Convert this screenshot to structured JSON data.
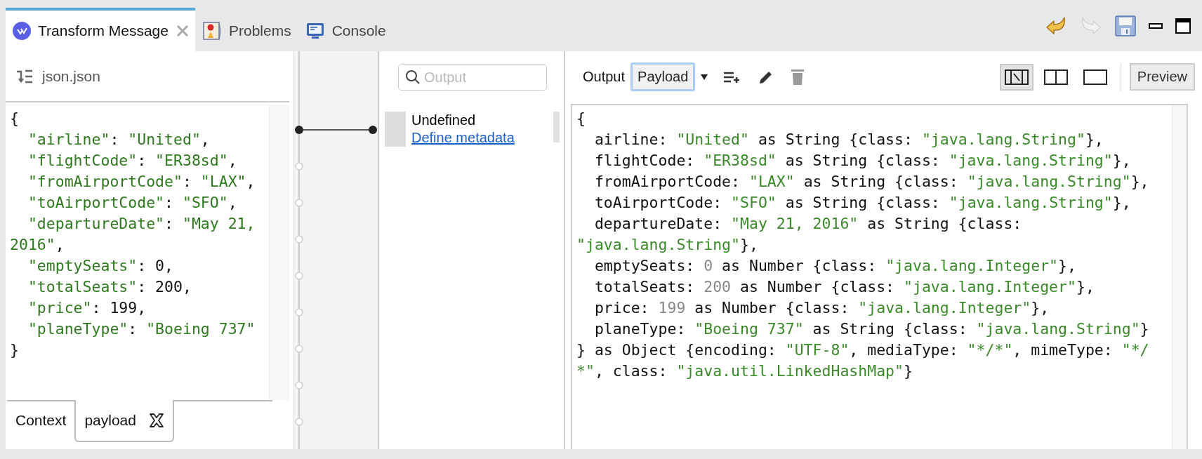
{
  "editor_tabs": [
    {
      "label": "Transform Message",
      "kind": "transform",
      "selected": true,
      "closable": true
    },
    {
      "label": "Problems",
      "kind": "problems",
      "selected": false,
      "closable": false
    },
    {
      "label": "Console",
      "kind": "console",
      "selected": false,
      "closable": false
    }
  ],
  "window_actions": [
    {
      "kind": "undo",
      "disabled": false
    },
    {
      "kind": "redo",
      "disabled": true
    },
    {
      "kind": "save"
    },
    {
      "kind": "minimize"
    },
    {
      "kind": "maximize"
    }
  ],
  "input_panel": {
    "title": "json.json",
    "code": [
      [
        {
          "kind": "plain",
          "text": "{"
        }
      ],
      [
        {
          "kind": "string",
          "text": "  \"airline\""
        },
        {
          "kind": "plain",
          "text": ": "
        },
        {
          "kind": "string",
          "text": "\"United\""
        },
        {
          "kind": "plain",
          "text": ","
        }
      ],
      [
        {
          "kind": "string",
          "text": "  \"flightCode\""
        },
        {
          "kind": "plain",
          "text": ": "
        },
        {
          "kind": "string",
          "text": "\"ER38sd\""
        },
        {
          "kind": "plain",
          "text": ","
        }
      ],
      [
        {
          "kind": "string",
          "text": "  \"fromAirportCode\""
        },
        {
          "kind": "plain",
          "text": ": "
        },
        {
          "kind": "string",
          "text": "\"LAX\""
        },
        {
          "kind": "plain",
          "text": ","
        }
      ],
      [
        {
          "kind": "string",
          "text": "  \"toAirportCode\""
        },
        {
          "kind": "plain",
          "text": ": "
        },
        {
          "kind": "string",
          "text": "\"SFO\""
        },
        {
          "kind": "plain",
          "text": ","
        }
      ],
      [
        {
          "kind": "string",
          "text": "  \"departureDate\""
        },
        {
          "kind": "plain",
          "text": ": "
        },
        {
          "kind": "string",
          "text": "\"May 21,"
        }
      ],
      [
        {
          "kind": "string",
          "text": "2016\""
        },
        {
          "kind": "plain",
          "text": ","
        }
      ],
      [
        {
          "kind": "string",
          "text": "  \"emptySeats\""
        },
        {
          "kind": "plain",
          "text": ": 0,"
        }
      ],
      [
        {
          "kind": "string",
          "text": "  \"totalSeats\""
        },
        {
          "kind": "plain",
          "text": ": 200,"
        }
      ],
      [
        {
          "kind": "string",
          "text": "  \"price\""
        },
        {
          "kind": "plain",
          "text": ": 199,"
        }
      ],
      [
        {
          "kind": "string",
          "text": "  \"planeType\""
        },
        {
          "kind": "plain",
          "text": ": "
        },
        {
          "kind": "string",
          "text": "\"Boeing 737\""
        }
      ],
      [
        {
          "kind": "plain",
          "text": "}"
        }
      ]
    ],
    "tabs": [
      {
        "label": "Context",
        "selected": false,
        "closable": false
      },
      {
        "label": "payload",
        "selected": true,
        "closable": true
      }
    ]
  },
  "mapping": {
    "search": {
      "placeholder": "Output"
    },
    "message": "Undefined",
    "link": "Define metadata"
  },
  "output_panel": {
    "label": "Output",
    "target": "Payload",
    "actions": [
      {
        "kind": "add",
        "disabled": false
      },
      {
        "kind": "edit",
        "disabled": false
      },
      {
        "kind": "delete",
        "disabled": true
      }
    ],
    "layouts": [
      {
        "kind": "diff",
        "selected": true
      },
      {
        "kind": "split",
        "selected": false
      },
      {
        "kind": "single",
        "selected": false
      }
    ],
    "preview_button": "Preview",
    "code": [
      [
        {
          "kind": "plain",
          "text": "{"
        }
      ],
      [
        {
          "kind": "plain",
          "text": "  airline: "
        },
        {
          "kind": "string",
          "text": "\"United\""
        },
        {
          "kind": "plain",
          "text": " as String {class: "
        },
        {
          "kind": "string",
          "text": "\"java.lang.String\""
        },
        {
          "kind": "plain",
          "text": "},"
        }
      ],
      [
        {
          "kind": "plain",
          "text": "  flightCode: "
        },
        {
          "kind": "string",
          "text": "\"ER38sd\""
        },
        {
          "kind": "plain",
          "text": " as String {class: "
        },
        {
          "kind": "string",
          "text": "\"java.lang.String\""
        },
        {
          "kind": "plain",
          "text": "},"
        }
      ],
      [
        {
          "kind": "plain",
          "text": "  fromAirportCode: "
        },
        {
          "kind": "string",
          "text": "\"LAX\""
        },
        {
          "kind": "plain",
          "text": " as String {class: "
        },
        {
          "kind": "string",
          "text": "\"java.lang.String\""
        },
        {
          "kind": "plain",
          "text": "},"
        }
      ],
      [
        {
          "kind": "plain",
          "text": "  toAirportCode: "
        },
        {
          "kind": "string",
          "text": "\"SFO\""
        },
        {
          "kind": "plain",
          "text": " as String {class: "
        },
        {
          "kind": "string",
          "text": "\"java.lang.String\""
        },
        {
          "kind": "plain",
          "text": "},"
        }
      ],
      [
        {
          "kind": "plain",
          "text": "  departureDate: "
        },
        {
          "kind": "string",
          "text": "\"May 21, 2016\""
        },
        {
          "kind": "plain",
          "text": " as String {class:"
        }
      ],
      [
        {
          "kind": "string",
          "text": "\"java.lang.String\""
        },
        {
          "kind": "plain",
          "text": "},"
        }
      ],
      [
        {
          "kind": "plain",
          "text": "  emptySeats: "
        },
        {
          "kind": "number",
          "text": "0"
        },
        {
          "kind": "plain",
          "text": " as Number {class: "
        },
        {
          "kind": "string",
          "text": "\"java.lang.Integer\""
        },
        {
          "kind": "plain",
          "text": "},"
        }
      ],
      [
        {
          "kind": "plain",
          "text": "  totalSeats: "
        },
        {
          "kind": "number",
          "text": "200"
        },
        {
          "kind": "plain",
          "text": " as Number {class: "
        },
        {
          "kind": "string",
          "text": "\"java.lang.Integer\""
        },
        {
          "kind": "plain",
          "text": "},"
        }
      ],
      [
        {
          "kind": "plain",
          "text": "  price: "
        },
        {
          "kind": "number",
          "text": "199"
        },
        {
          "kind": "plain",
          "text": " as Number {class: "
        },
        {
          "kind": "string",
          "text": "\"java.lang.Integer\""
        },
        {
          "kind": "plain",
          "text": "},"
        }
      ],
      [
        {
          "kind": "plain",
          "text": "  planeType: "
        },
        {
          "kind": "string",
          "text": "\"Boeing 737\""
        },
        {
          "kind": "plain",
          "text": " as String {class: "
        },
        {
          "kind": "string",
          "text": "\"java.lang.String\""
        },
        {
          "kind": "plain",
          "text": "}"
        }
      ],
      [
        {
          "kind": "plain",
          "text": "} as Object {encoding: "
        },
        {
          "kind": "string",
          "text": "\"UTF-8\""
        },
        {
          "kind": "plain",
          "text": ", mediaType: "
        },
        {
          "kind": "string",
          "text": "\"*/*\""
        },
        {
          "kind": "plain",
          "text": ", mimeType: "
        },
        {
          "kind": "string",
          "text": "\"*/"
        }
      ],
      [
        {
          "kind": "string",
          "text": "*\""
        },
        {
          "kind": "plain",
          "text": ", class: "
        },
        {
          "kind": "string",
          "text": "\"java.util.LinkedHashMap\""
        },
        {
          "kind": "plain",
          "text": "}"
        }
      ]
    ]
  }
}
